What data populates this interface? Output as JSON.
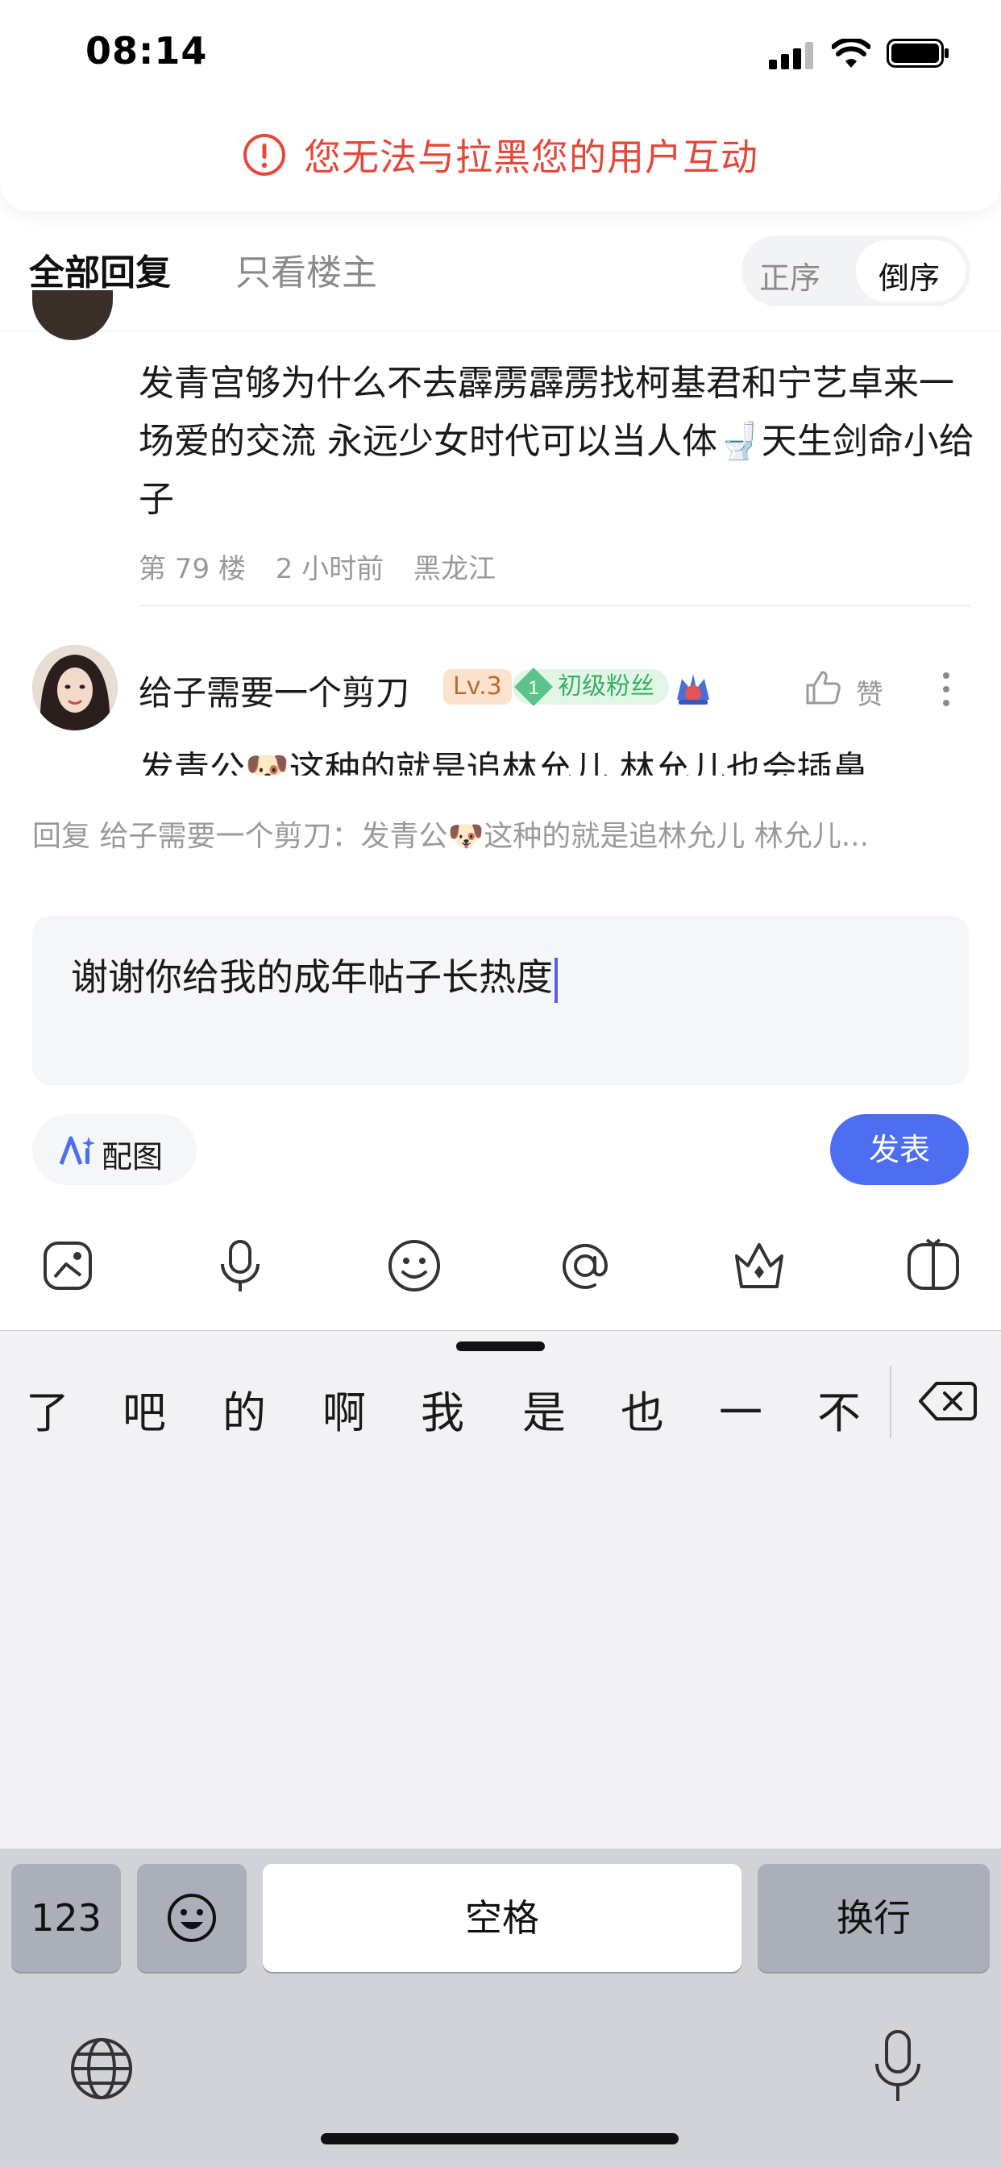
{
  "status_bar": {
    "time": "08:14"
  },
  "alert": {
    "text": "您无法与拉黑您的用户互动",
    "color": "#e5483a"
  },
  "tabs": {
    "all_replies": "全部回复",
    "only_op": "只看楼主"
  },
  "sort": {
    "ascending": "正序",
    "descending": "倒序",
    "selected": "倒序"
  },
  "post": {
    "text": "发青宫够为什么不去霹雳霹雳找柯基君和宁艺卓来一场爱的交流 永远少女时代可以当人体🚽天生剑命小给子",
    "floor": "第 79 楼",
    "time": "2 小时前",
    "location": "黑龙江"
  },
  "reply": {
    "username": "给子需要一个剪刀",
    "level": "Lv.3",
    "fan_level": "1",
    "fan_badge": "初级粉丝",
    "like_label": "赞",
    "text_preview": "发青公🐶这种的就是追林允儿 林允儿也会插鼻"
  },
  "compose": {
    "quote": "回复 给子需要一个剪刀：发青公🐶这种的就是追林允儿 林允儿...",
    "input_value": "谢谢你给我的成年帖子长热度",
    "ai_image_label": "配图",
    "publish_label": "发表",
    "accent": "#4e6ef2",
    "tools": [
      "sticker-icon",
      "voice-icon",
      "emoji-icon",
      "mention-icon",
      "gift-icon",
      "topic-icon"
    ]
  },
  "keyboard": {
    "candidates": [
      "了",
      "吧",
      "的",
      "啊",
      "我",
      "是",
      "也",
      "一",
      "不"
    ],
    "key_123": "123",
    "space": "空格",
    "return": "换行"
  }
}
